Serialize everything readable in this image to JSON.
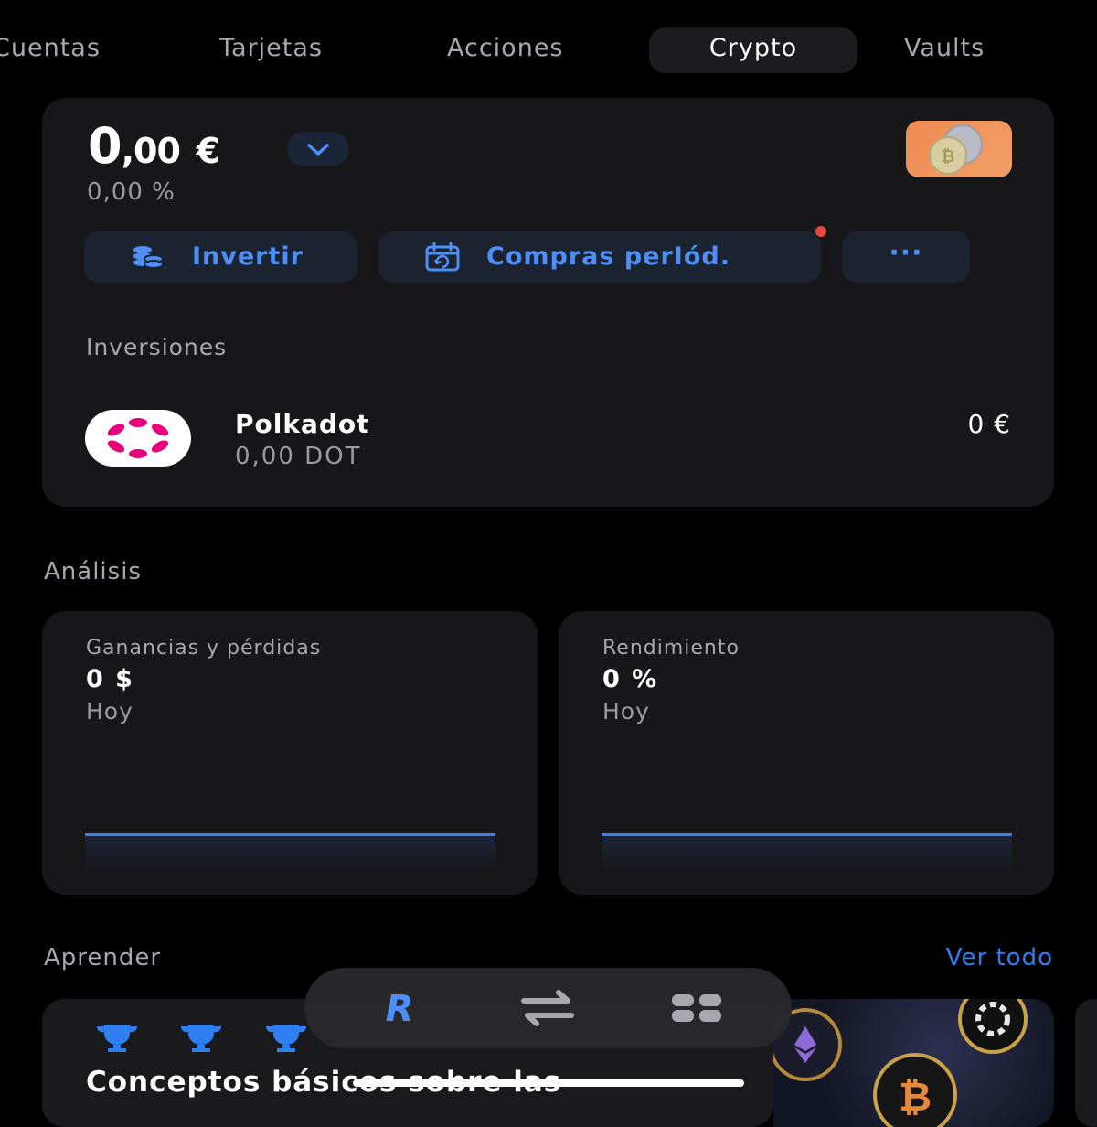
{
  "tabs": [
    {
      "label": "Cuentas"
    },
    {
      "label": "Tarjetas"
    },
    {
      "label": "Acciones"
    },
    {
      "label": "Crypto",
      "active": true
    },
    {
      "label": "Vaults"
    }
  ],
  "portfolio": {
    "balance_main": "0",
    "balance_dec": ",00",
    "currency": "€",
    "change": "0,00 %"
  },
  "actions": {
    "invest": "Invertir",
    "recurring": "Compras perIód.",
    "more": "···"
  },
  "investments": {
    "title": "Inversiones",
    "items": [
      {
        "name": "Polkadot",
        "amount": "0,00  DOT",
        "value": "0 €"
      }
    ]
  },
  "analysis": {
    "title": "Análisis",
    "cards": [
      {
        "title": "Ganancias y pérdidas",
        "value": "0 $",
        "period": "Hoy"
      },
      {
        "title": "Rendimiento",
        "value": "0 %",
        "period": "Hoy"
      }
    ]
  },
  "learn": {
    "title": "Aprender",
    "see_all": "Ver todo",
    "card_text": "Conceptos básicos sobre las"
  },
  "colors": {
    "accent": "#2f7ff2",
    "pill_bg": "#1b2330",
    "card_bg": "#17171a",
    "notification": "#e5483f",
    "polkadot": "#e6007a"
  },
  "icons": [
    "chevron-down-icon",
    "crypto-coins-icon",
    "coins-stack-icon",
    "calendar-repeat-icon",
    "more-dots-icon",
    "polkadot-logo",
    "trophy-icon",
    "revolut-icon",
    "transfer-arrows-icon",
    "grid-icon"
  ]
}
